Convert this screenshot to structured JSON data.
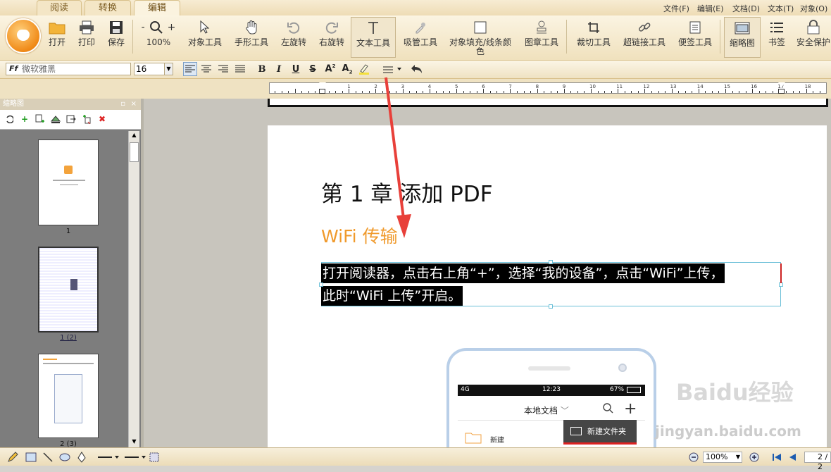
{
  "tabs": [
    "阅读",
    "转换",
    "编辑"
  ],
  "menus": [
    "文件(F)",
    "编辑(E)",
    "文档(D)",
    "文本(T)",
    "对象(O)"
  ],
  "toolbar": {
    "open": "打开",
    "print": "打印",
    "save": "保存",
    "zoom": "100%",
    "object_tool": "对象工具",
    "hand_tool": "手形工具",
    "rotate_left": "左旋转",
    "rotate_right": "右旋转",
    "text_tool": "文本工具",
    "eyedropper": "吸管工具",
    "fill_color_1": "对象填充/线条颜",
    "fill_color_2": "色",
    "stamp_tool": "图章工具",
    "crop_tool": "裁切工具",
    "link_tool": "超链接工具",
    "note_tool": "便签工具",
    "thumbnails": "缩略图",
    "bookmarks": "书签",
    "security": "安全保护",
    "zoom_minus": "-",
    "zoom_plus": "+"
  },
  "format": {
    "font": "微软雅黑",
    "size": "16",
    "bold": "B",
    "italic": "I",
    "underline": "U",
    "strike": "S"
  },
  "ruler_numbers": [
    "1",
    "2",
    "3",
    "4",
    "5",
    "6",
    "7",
    "8",
    "9",
    "10",
    "11",
    "12",
    "13",
    "14",
    "15",
    "16",
    "17",
    "18"
  ],
  "sidebar": {
    "title": "缩略图",
    "thumbs": [
      {
        "caption": "1"
      },
      {
        "caption": "1 (2)"
      },
      {
        "caption": "2 (3)"
      }
    ]
  },
  "document": {
    "heading": "第 1 章 添加 PDF",
    "subheading": "WiFi 传输",
    "line1": "打开阅读器，点击右上角“+”，选择“我的设备”，点击“WiFi”上传，",
    "line2": "此时“WiFi 上传”开启。"
  },
  "phone": {
    "signal": "4G",
    "time": "12:23",
    "battery": "67%",
    "title": "本地文档",
    "new_folder": "新建文件夹",
    "new": "新建"
  },
  "watermark": {
    "line1": "Baidu经验",
    "line2": "jingyan.baidu.com"
  },
  "bottom": {
    "zoom": "100%",
    "page": "2 / 2"
  },
  "colors": {
    "accent": "#f09a2c",
    "arrow": "#e8403a"
  }
}
